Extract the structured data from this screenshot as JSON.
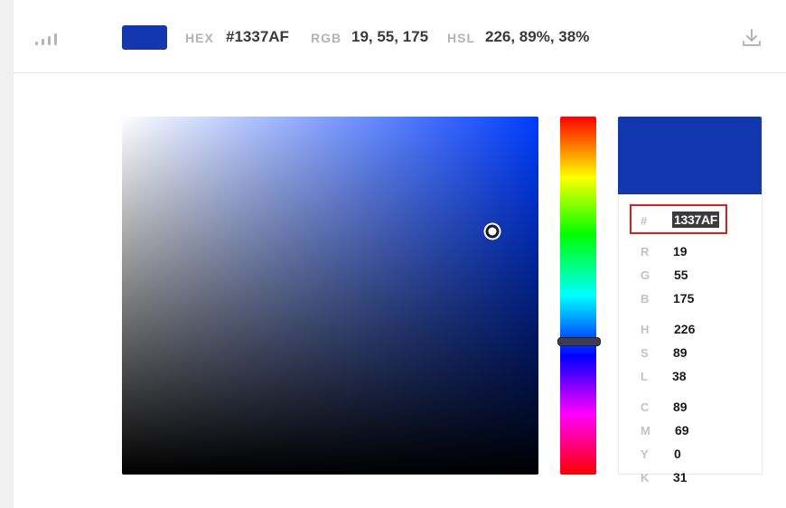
{
  "color": {
    "hex_swatch": "#1337AF"
  },
  "top_swatches": [
    "#6b1d4a",
    "#9e1b4d",
    "#b5154d",
    "#c41957",
    "#ef5a32"
  ],
  "toolbar": {
    "hex_label": "HEX",
    "hex_value": "#1337AF",
    "rgb_label": "RGB",
    "rgb_value": "19, 55, 175",
    "hsl_label": "HSL",
    "hsl_value": "226, 89%, 38%",
    "icons": {
      "stats": "bar-chart-icon",
      "download": "download-icon"
    }
  },
  "picker": {
    "hue": 226,
    "saturation_value": [
      0.89,
      0.68
    ]
  },
  "values": {
    "hash_label": "#",
    "hex": "1337AF",
    "r_label": "R",
    "r": "19",
    "g_label": "G",
    "g": "55",
    "b_label": "B",
    "b": "175",
    "h_label": "H",
    "h": "226",
    "s_label": "S",
    "s": "89",
    "l_label": "L",
    "l": "38",
    "c_label": "C",
    "c": "89",
    "m_label": "M",
    "m": "69",
    "y_label": "Y",
    "y": "0",
    "k_label": "K",
    "k": "31"
  }
}
